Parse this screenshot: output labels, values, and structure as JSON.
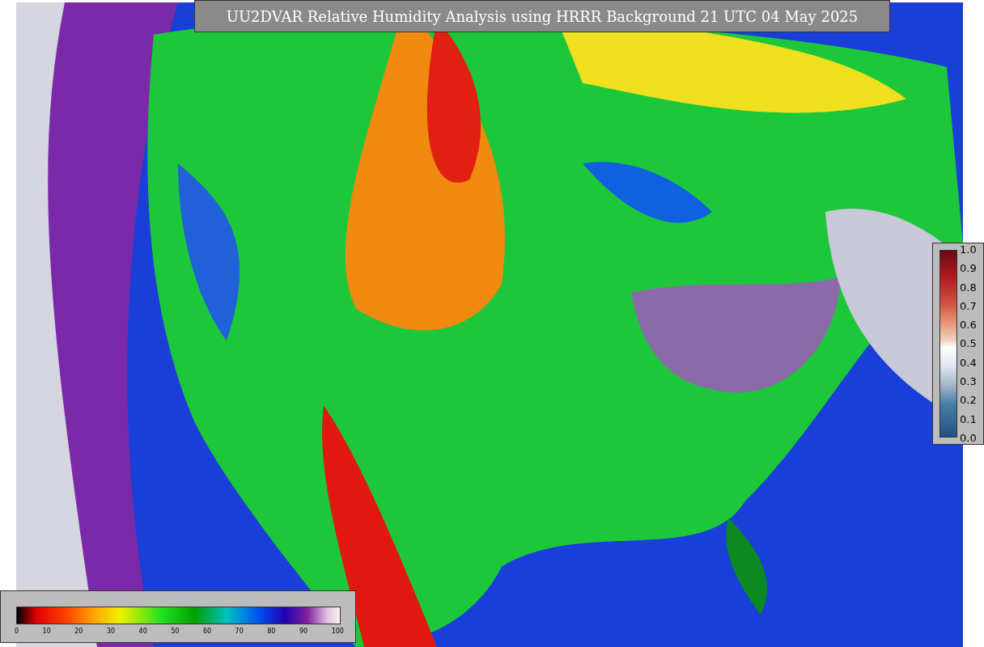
{
  "title": "UU2DVAR Relative Humidity Analysis using HRRR Background 21 UTC 04 May 2025",
  "ratio_legend": {
    "ticks": [
      "1.0",
      "0.9",
      "0.8",
      "0.7",
      "0.6",
      "0.5",
      "0.4",
      "0.3",
      "0.2",
      "0.1",
      "0.0"
    ]
  },
  "humidity_legend": {
    "ticks": [
      "0",
      "10",
      "20",
      "30",
      "40",
      "50",
      "60",
      "70",
      "80",
      "90",
      "100"
    ]
  }
}
